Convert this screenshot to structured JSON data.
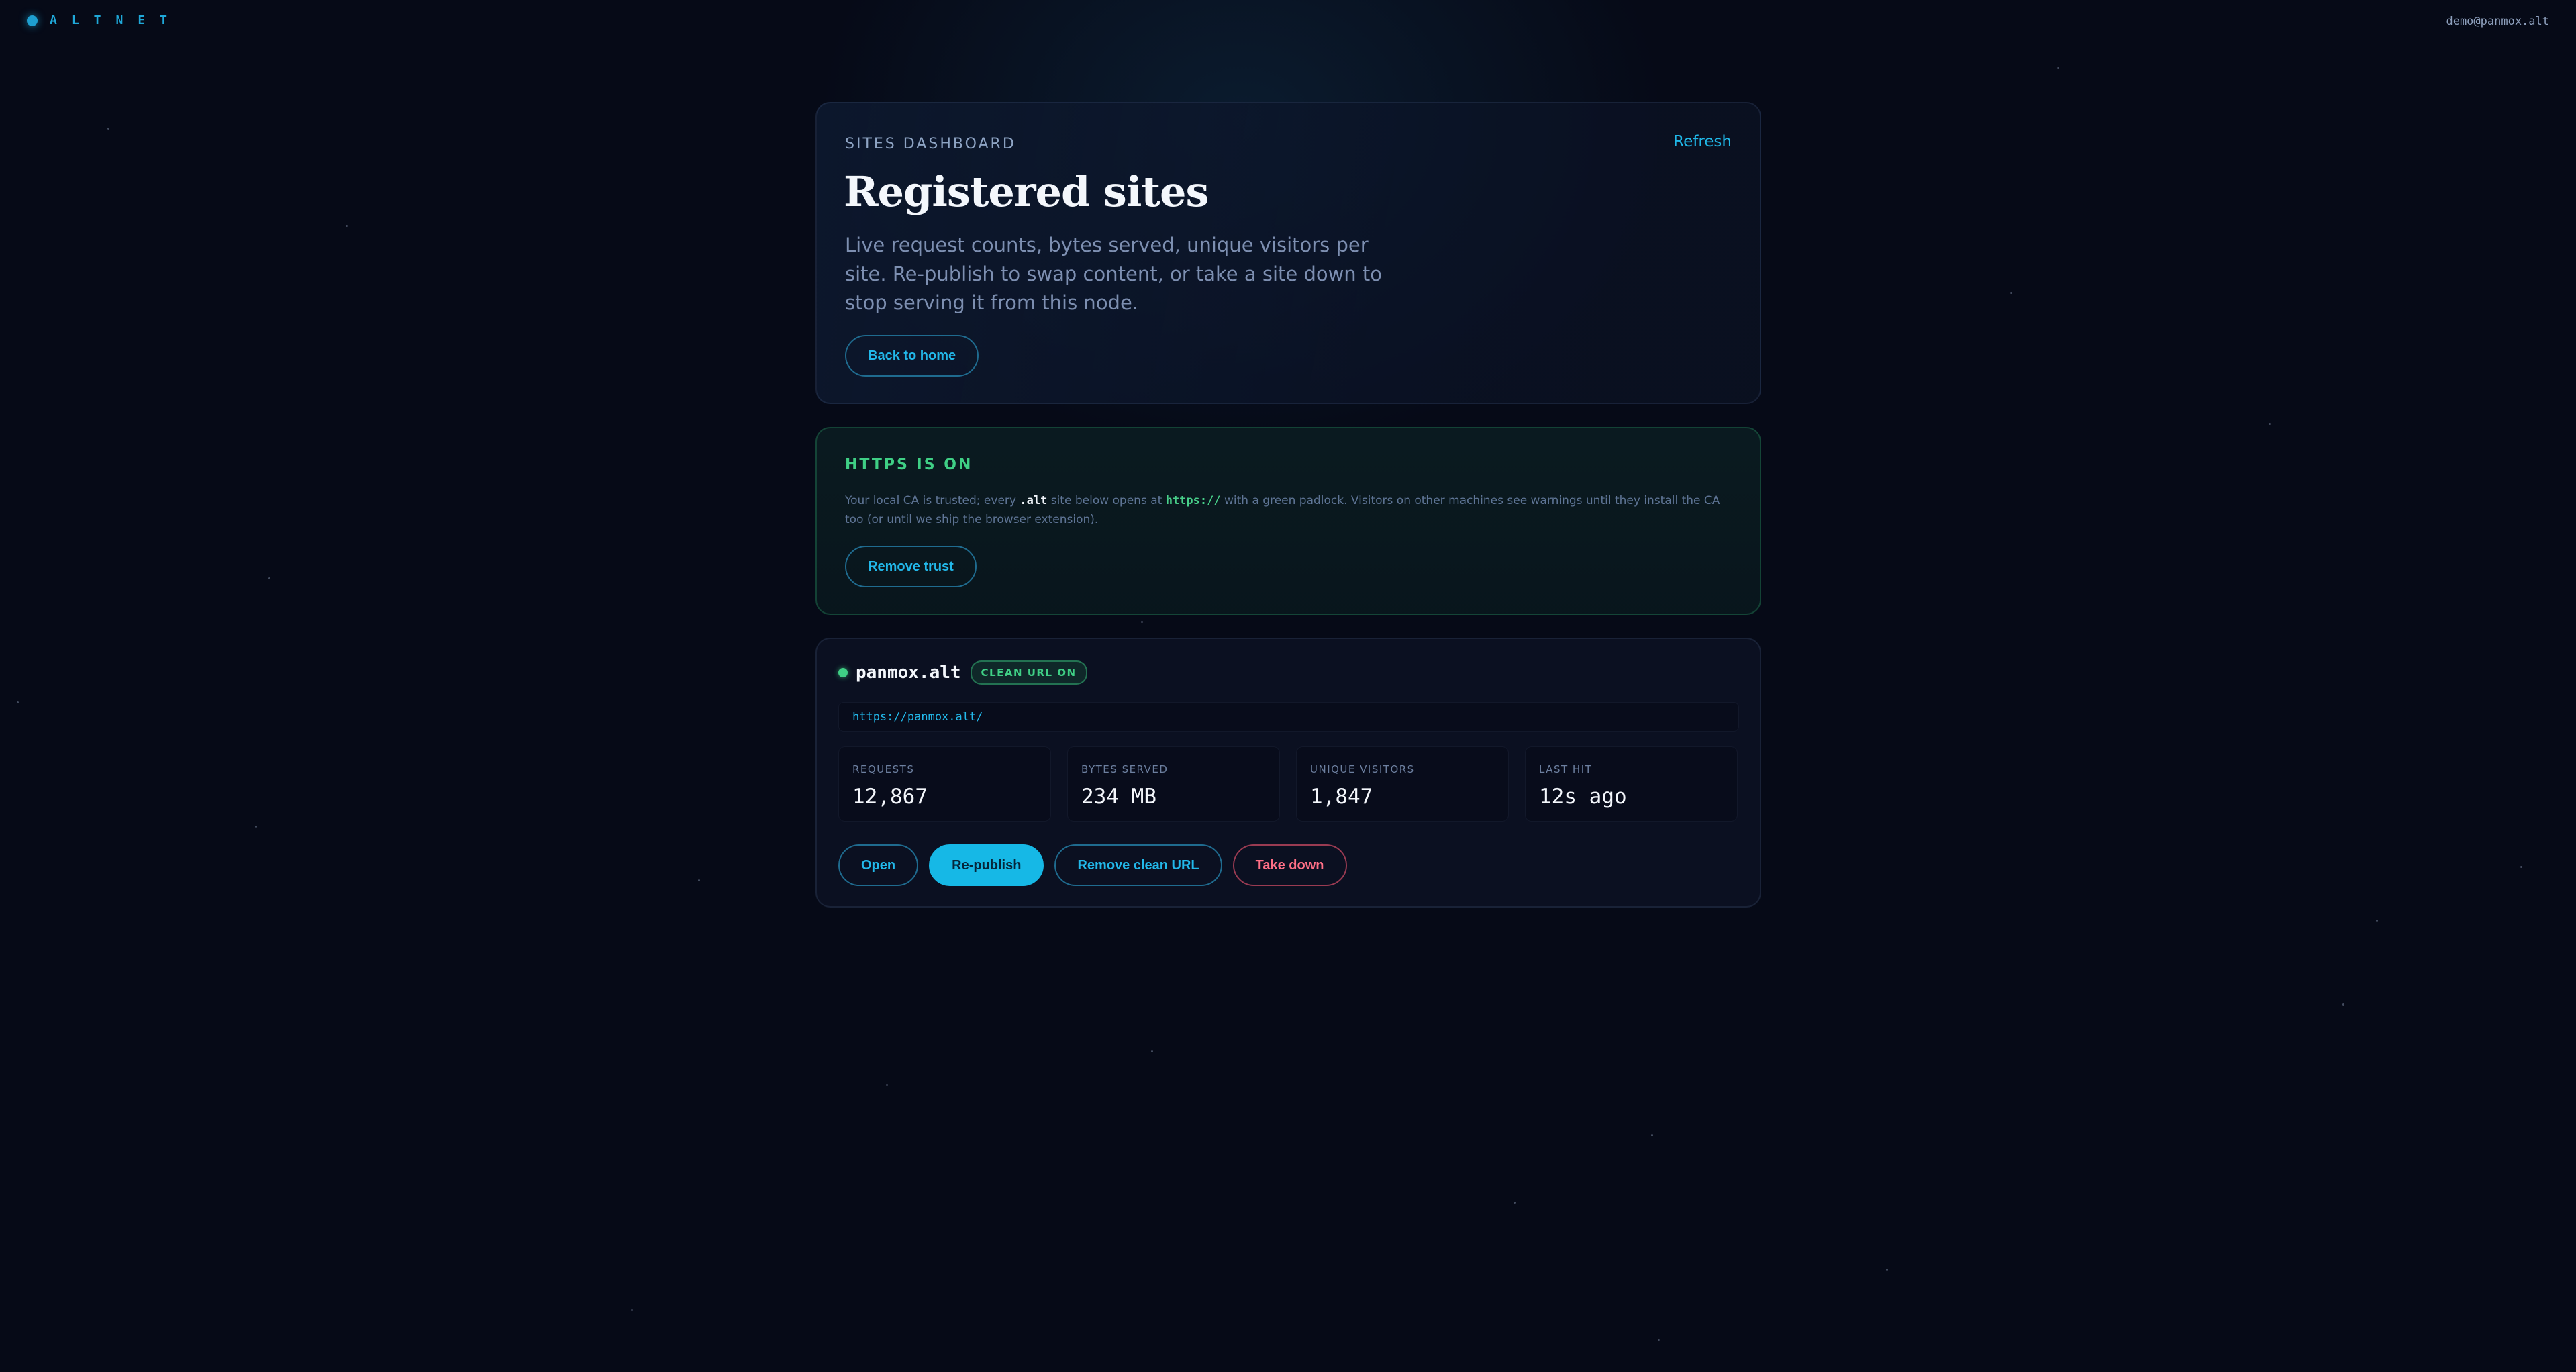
{
  "topbar": {
    "brand": "ALTNET",
    "user_email": "demo@panmox.alt"
  },
  "hero": {
    "eyebrow": "SITES DASHBOARD",
    "refresh_label": "Refresh",
    "title": "Registered sites",
    "description": "Live request counts, bytes served, unique visitors per site. Re-publish to swap content, or take a site down to stop serving it from this node.",
    "back_label": "Back to home"
  },
  "https_notice": {
    "title": "HTTPS IS ON",
    "text_1": "Your local CA is trusted; every ",
    "code_1": ".alt",
    "text_2": " site below opens at ",
    "code_2": "https://",
    "text_3": " with a green padlock. Visitors on other machines see warnings until they install the CA too (or until we ship the browser extension).",
    "remove_trust_label": "Remove trust"
  },
  "site": {
    "name": "panmox.alt",
    "status": "online",
    "badge": "CLEAN URL ON",
    "url": "https://panmox.alt/",
    "stats": [
      {
        "label": "REQUESTS",
        "value": "12,867"
      },
      {
        "label": "BYTES SERVED",
        "value": "234 MB"
      },
      {
        "label": "UNIQUE VISITORS",
        "value": "1,847"
      },
      {
        "label": "LAST HIT",
        "value": "12s ago"
      }
    ],
    "actions": {
      "open_label": "Open",
      "republish_label": "Re-publish",
      "remove_clean_url_label": "Remove clean URL",
      "take_down_label": "Take down"
    }
  },
  "colors": {
    "background": "#060a17",
    "accent": "#16b8e6",
    "success": "#3fcf85",
    "danger": "#ff6f86"
  }
}
